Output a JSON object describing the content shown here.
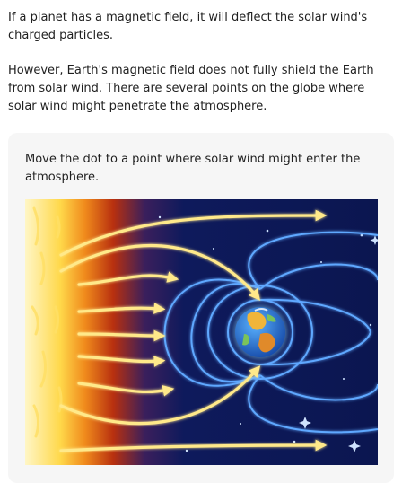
{
  "intro": {
    "paragraph1": "If a planet has a magnetic field, it will deflect the solar wind's charged particles.",
    "paragraph2": "However, Earth's magnetic field does not fully shield the Earth from solar wind. There are several points on the globe where solar wind might penetrate the atmosphere."
  },
  "activity": {
    "prompt": "Move the dot to a point where solar wind might enter the atmosphere."
  },
  "scene": {
    "colors": {
      "space": "#0e1a5c",
      "sun_core": "#fff3b0",
      "sun_edge": "#e85d12",
      "wind_stream": "#ffe98a",
      "field_line": "#5fa8ff",
      "earth_ocean": "#1f6fd1",
      "earth_land": "#f0b53a"
    },
    "icons": [
      "sun-icon",
      "earth-icon",
      "star-icon"
    ]
  }
}
